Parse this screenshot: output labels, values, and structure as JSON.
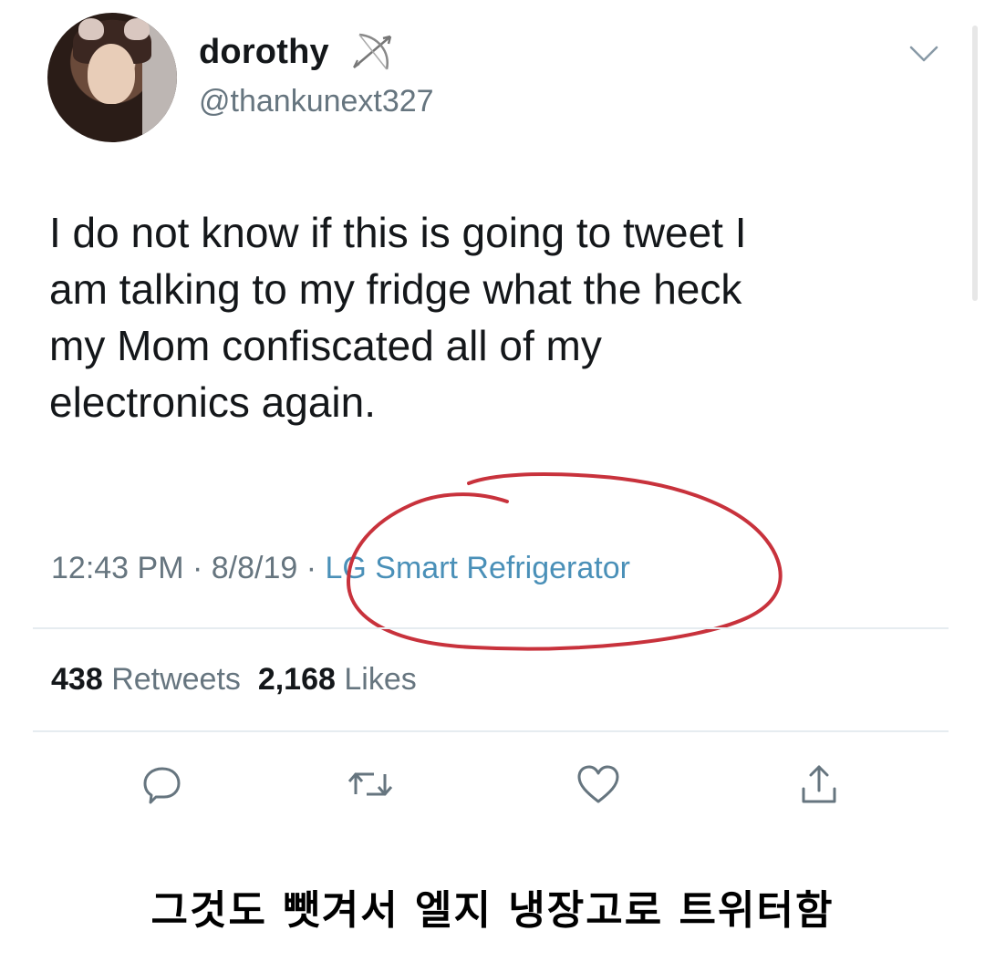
{
  "tweet": {
    "display_name": "dorothy",
    "handle": "@thankunext327",
    "text": "I do not know if this is going to tweet I\nam talking to my fridge what the heck\nmy Mom confiscated all of my\nelectronics again.",
    "time": "12:43 PM · 8/8/19",
    "source_separator": " · ",
    "source": "LG Smart Refrigerator",
    "retweet_count": "438",
    "retweet_label": "Retweets",
    "like_count": "2,168",
    "like_label": "Likes"
  },
  "icons": {
    "name_emoji": "bow-and-arrow-icon",
    "menu": "chevron-down-icon",
    "reply": "reply-icon",
    "retweet": "retweet-icon",
    "like": "heart-icon",
    "share": "share-icon"
  },
  "annotation": {
    "color": "#c8323c"
  },
  "caption": "그것도 뺏겨서 엘지 냉장고로 트위터함"
}
